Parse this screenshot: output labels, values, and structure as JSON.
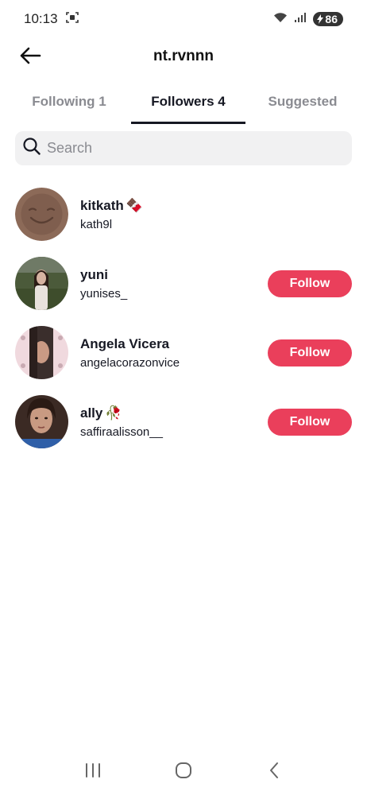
{
  "status_bar": {
    "time": "10:13",
    "battery": "86",
    "icons": [
      "screenshot-icon",
      "wifi-icon",
      "signal-icon",
      "battery-charging-icon"
    ]
  },
  "header": {
    "title": "nt.rvnnn",
    "back_icon": "arrow-left-icon"
  },
  "tabs": [
    {
      "label": "Following 1",
      "active": false
    },
    {
      "label": "Followers 4",
      "active": true
    },
    {
      "label": "Suggested",
      "active": false
    }
  ],
  "search": {
    "placeholder": "Search",
    "value": ""
  },
  "followers": [
    {
      "display_name": "kitkath",
      "emoji": "🍫",
      "username": "kath9l",
      "follow_label": ""
    },
    {
      "display_name": "yuni",
      "emoji": "",
      "username": "yunises_",
      "follow_label": "Follow"
    },
    {
      "display_name": "Angela Vicera",
      "emoji": "",
      "username": "angelacorazonvice",
      "follow_label": "Follow"
    },
    {
      "display_name": "ally",
      "emoji": "🥀",
      "username": "saffiraalisson__",
      "follow_label": "Follow"
    }
  ],
  "colors": {
    "accent": "#ea3f5b",
    "text_primary": "#161823",
    "text_secondary": "#8a8b91",
    "search_bg": "#f1f1f2"
  },
  "nav_bar": {
    "icons": [
      "recents-icon",
      "home-icon",
      "back-icon"
    ]
  }
}
